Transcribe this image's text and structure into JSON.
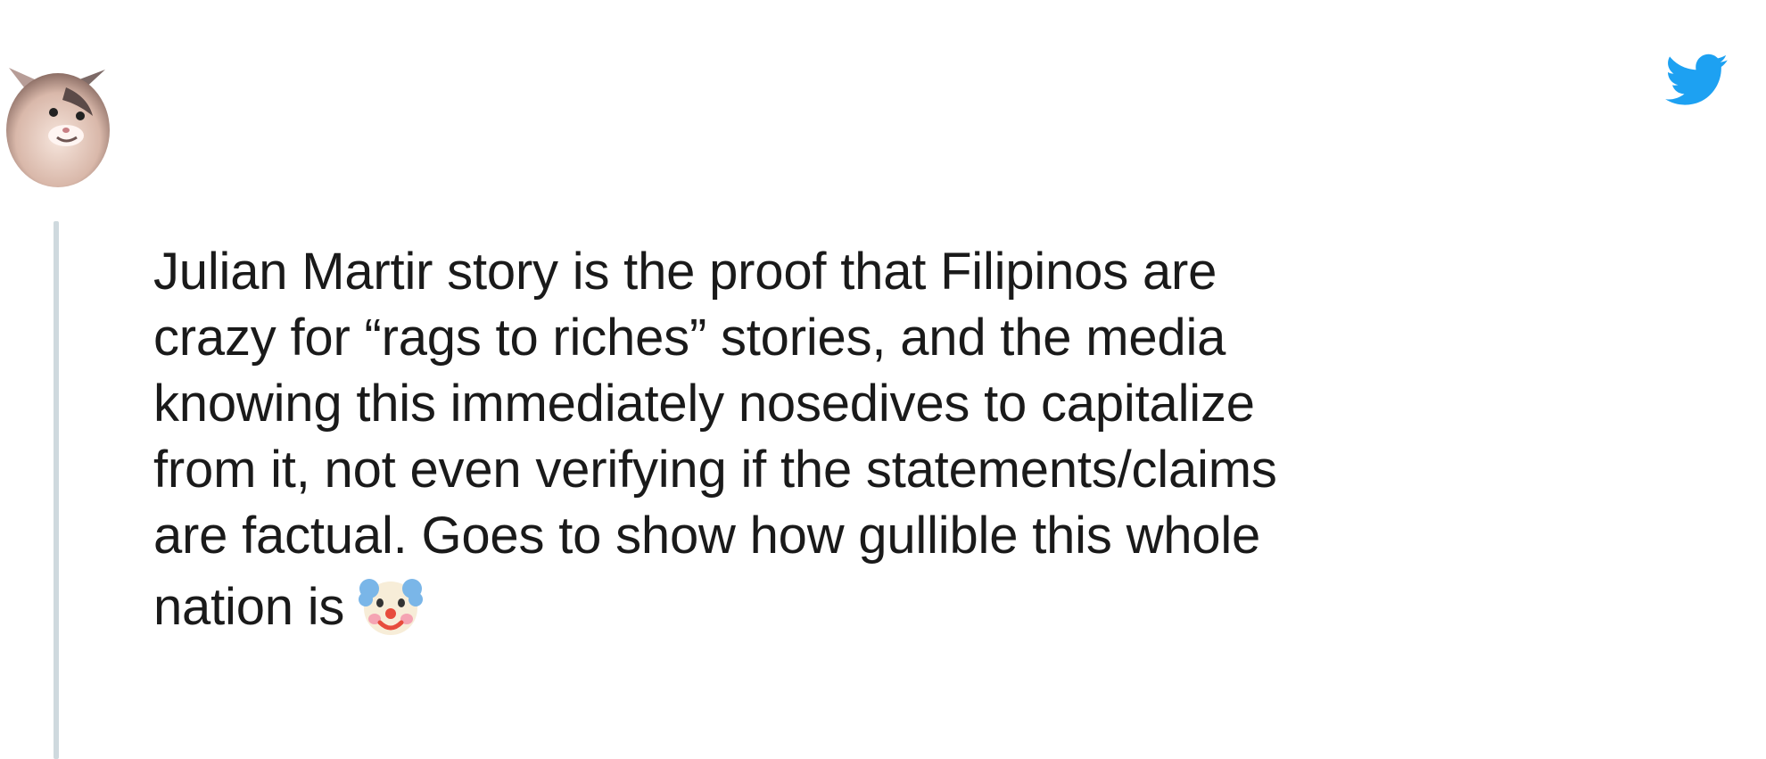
{
  "tweet": {
    "author_avatar_icon": "cat-avatar",
    "brand_icon": "twitter-bird-icon",
    "brand_color": "#1da1f2",
    "thread_line_color": "#cfd9de",
    "text_lines": [
      "Julian Martir story is the proof that Filipinos are",
      "crazy for “rags to riches” stories, and the media",
      "knowing this immediately nosedives to capitalize",
      "from it, not even verifying if the statements/claims",
      "are factual. Goes to show how gullible this whole",
      "nation is"
    ],
    "emoji": "clown-face-emoji"
  }
}
